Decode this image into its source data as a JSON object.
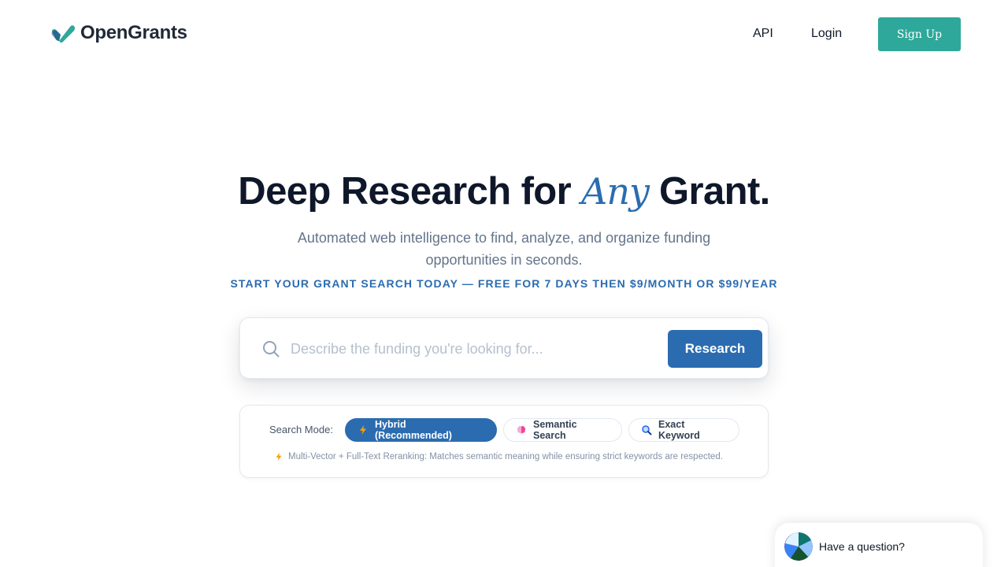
{
  "header": {
    "brand": "OpenGrants",
    "nav": {
      "api": "API",
      "login": "Login",
      "signup": "Sign Up"
    },
    "colors": {
      "brand_green": "#2ea89a",
      "brand_blue": "#2b6cb0"
    }
  },
  "hero": {
    "title_before": "Deep Research for ",
    "title_accent": "Any",
    "title_after": " Grant.",
    "subtitle": "Automated web intelligence to find, analyze, and organize funding opportunities in seconds.",
    "promo": "START YOUR GRANT SEARCH TODAY — FREE FOR 7 DAYS THEN $9/MONTH OR $99/YEAR"
  },
  "search": {
    "placeholder": "Describe the funding you're looking for...",
    "value": "",
    "button": "Research",
    "icon": "search-icon"
  },
  "modes": {
    "label": "Search Mode:",
    "options": [
      {
        "label": "Hybrid (Recommended)",
        "icon": "lightning-icon",
        "selected": true
      },
      {
        "label": "Semantic Search",
        "icon": "brain-icon",
        "selected": false
      },
      {
        "label": "Exact Keyword",
        "icon": "magnifier-icon",
        "selected": false
      }
    ],
    "description": "Multi-Vector + Full-Text Reranking: Matches semantic meaning while ensuring strict keywords are respected."
  },
  "chat": {
    "text": "Have a question?",
    "icon": "chat-avatar"
  }
}
